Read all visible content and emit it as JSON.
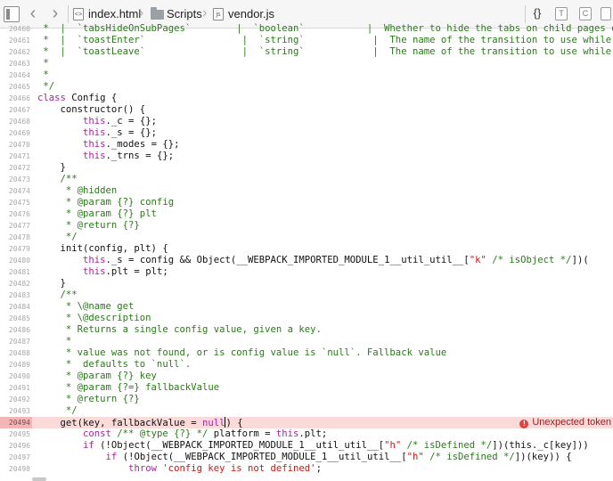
{
  "breadcrumbs": {
    "file1": "index.html",
    "folder": "Scripts",
    "file2": "vendor.js"
  },
  "toolbar": {
    "braces": "{}",
    "t_label": "T",
    "c_label": "C"
  },
  "error": {
    "message": "Unexpected token"
  },
  "lines": [
    {
      "n": "20460",
      "segs": [
        [
          "c",
          " *  |  `tabsHideOnSubPages`        |  `boolean`           |  Whether to hide the tabs on child pages or"
        ]
      ]
    },
    {
      "n": "20461",
      "segs": [
        [
          "c",
          " *  |  `toastEnter`                 |  `string`            |  The name of the transition to use while a t"
        ]
      ]
    },
    {
      "n": "20462",
      "segs": [
        [
          "c",
          " *  |  `toastLeave`                 |  `string`            |  The name of the transition to use while a t"
        ]
      ]
    },
    {
      "n": "20463",
      "segs": [
        [
          "c",
          " *"
        ]
      ]
    },
    {
      "n": "20464",
      "segs": [
        [
          "c",
          " *"
        ]
      ]
    },
    {
      "n": "20465",
      "segs": [
        [
          "c",
          " */"
        ]
      ]
    },
    {
      "n": "20466",
      "segs": [
        [
          "k",
          "class"
        ],
        [
          "p",
          " Config {"
        ]
      ]
    },
    {
      "n": "20467",
      "segs": [
        [
          "p",
          "    constructor() {"
        ]
      ]
    },
    {
      "n": "20468",
      "segs": [
        [
          "p",
          "        "
        ],
        [
          "k",
          "this"
        ],
        [
          "p",
          "._c = {};"
        ]
      ]
    },
    {
      "n": "20469",
      "segs": [
        [
          "p",
          "        "
        ],
        [
          "k",
          "this"
        ],
        [
          "p",
          "._s = {};"
        ]
      ]
    },
    {
      "n": "20470",
      "segs": [
        [
          "p",
          "        "
        ],
        [
          "k",
          "this"
        ],
        [
          "p",
          "._modes = {};"
        ]
      ]
    },
    {
      "n": "20471",
      "segs": [
        [
          "p",
          "        "
        ],
        [
          "k",
          "this"
        ],
        [
          "p",
          "._trns = {};"
        ]
      ]
    },
    {
      "n": "20472",
      "segs": [
        [
          "p",
          "    }"
        ]
      ]
    },
    {
      "n": "20473",
      "segs": [
        [
          "c",
          "    /**"
        ]
      ]
    },
    {
      "n": "20474",
      "segs": [
        [
          "c",
          "     * @hidden"
        ]
      ]
    },
    {
      "n": "20475",
      "segs": [
        [
          "c",
          "     * @param {?} config"
        ]
      ]
    },
    {
      "n": "20476",
      "segs": [
        [
          "c",
          "     * @param {?} plt"
        ]
      ]
    },
    {
      "n": "20477",
      "segs": [
        [
          "c",
          "     * @return {?}"
        ]
      ]
    },
    {
      "n": "20478",
      "segs": [
        [
          "c",
          "     */"
        ]
      ]
    },
    {
      "n": "20479",
      "segs": [
        [
          "p",
          "    init(config, plt) {"
        ]
      ]
    },
    {
      "n": "20480",
      "segs": [
        [
          "p",
          "        "
        ],
        [
          "k",
          "this"
        ],
        [
          "p",
          "._s = config && Object(__WEBPACK_IMPORTED_MODULE_1__util_util__["
        ],
        [
          "s",
          "\"k\""
        ],
        [
          "c",
          " /* isObject */"
        ],
        [
          "p",
          "])("
        ]
      ]
    },
    {
      "n": "20481",
      "segs": [
        [
          "p",
          "        "
        ],
        [
          "k",
          "this"
        ],
        [
          "p",
          ".plt = plt;"
        ]
      ]
    },
    {
      "n": "20482",
      "segs": [
        [
          "p",
          "    }"
        ]
      ]
    },
    {
      "n": "20483",
      "segs": [
        [
          "c",
          "    /**"
        ]
      ]
    },
    {
      "n": "20484",
      "segs": [
        [
          "c",
          "     * \\@name get"
        ]
      ]
    },
    {
      "n": "20485",
      "segs": [
        [
          "c",
          "     * \\@description"
        ]
      ]
    },
    {
      "n": "20486",
      "segs": [
        [
          "c",
          "     * Returns a single config value, given a key."
        ]
      ]
    },
    {
      "n": "20487",
      "segs": [
        [
          "c",
          "     *"
        ]
      ]
    },
    {
      "n": "20488",
      "segs": [
        [
          "c",
          "     * value was not found, or is config value is `null`. Fallback value"
        ]
      ]
    },
    {
      "n": "20489",
      "segs": [
        [
          "c",
          "     *  defaults to `null`."
        ]
      ]
    },
    {
      "n": "20490",
      "segs": [
        [
          "c",
          "     * @param {?} key"
        ]
      ]
    },
    {
      "n": "20491",
      "segs": [
        [
          "c",
          "     * @param {?=} fallbackValue"
        ]
      ]
    },
    {
      "n": "20492",
      "segs": [
        [
          "c",
          "     * @return {?}"
        ]
      ]
    },
    {
      "n": "20493",
      "segs": [
        [
          "c",
          "     */"
        ]
      ]
    },
    {
      "n": "20494",
      "err": true,
      "segs": [
        [
          "p",
          "    get(key, fallbackValue = "
        ],
        [
          "k",
          "null"
        ],
        [
          "p",
          ") {"
        ]
      ]
    },
    {
      "n": "20495",
      "segs": [
        [
          "p",
          "        "
        ],
        [
          "k",
          "const"
        ],
        [
          "c",
          " /** @type {?} */"
        ],
        [
          "p",
          " platform = "
        ],
        [
          "k",
          "this"
        ],
        [
          "p",
          ".plt;"
        ]
      ]
    },
    {
      "n": "20496",
      "segs": [
        [
          "p",
          "        "
        ],
        [
          "k",
          "if"
        ],
        [
          "p",
          " (!Object(__WEBPACK_IMPORTED_MODULE_1__util_util__["
        ],
        [
          "s",
          "\"h\""
        ],
        [
          "c",
          " /* isDefined */"
        ],
        [
          "p",
          "])(this._c[key]))"
        ]
      ]
    },
    {
      "n": "20497",
      "segs": [
        [
          "p",
          "            "
        ],
        [
          "k",
          "if"
        ],
        [
          "p",
          " (!Object(__WEBPACK_IMPORTED_MODULE_1__util_util__["
        ],
        [
          "s",
          "\"h\""
        ],
        [
          "c",
          " /* isDefined */"
        ],
        [
          "p",
          "])(key)) {"
        ]
      ]
    },
    {
      "n": "20498",
      "segs": [
        [
          "p",
          "                "
        ],
        [
          "k",
          "throw"
        ],
        [
          "p",
          " "
        ],
        [
          "s",
          "'config key is not defined'"
        ],
        [
          "p",
          ";"
        ]
      ]
    }
  ]
}
